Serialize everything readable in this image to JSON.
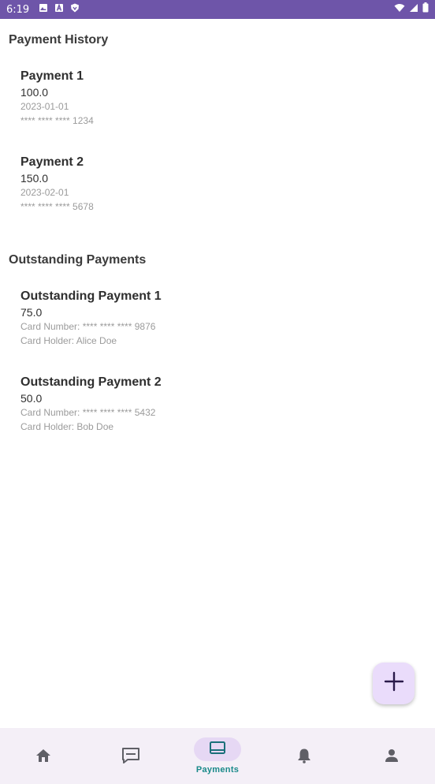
{
  "status_bar": {
    "time": "6:19",
    "left_icons": [
      "image-icon",
      "a-icon",
      "shield-icon"
    ],
    "right_icons": [
      "wifi-icon",
      "signal-icon",
      "battery-icon"
    ],
    "background": "#6e55a9"
  },
  "payment_history": {
    "title": "Payment History",
    "items": [
      {
        "title": "Payment 1",
        "amount": "100.0",
        "date": "2023-01-01",
        "card": "**** **** **** 1234"
      },
      {
        "title": "Payment 2",
        "amount": "150.0",
        "date": "2023-02-01",
        "card": "**** **** **** 5678"
      }
    ]
  },
  "outstanding_payments": {
    "title": "Outstanding Payments",
    "items": [
      {
        "title": "Outstanding Payment 1",
        "amount": "75.0",
        "card": "Card Number: **** **** **** 9876",
        "holder": "Card Holder: Alice Doe"
      },
      {
        "title": "Outstanding Payment 2",
        "amount": "50.0",
        "card": "Card Number: **** **** **** 5432",
        "holder": "Card Holder: Bob Doe"
      }
    ]
  },
  "fab": {
    "icon": "plus-icon",
    "color": "#eadcfb"
  },
  "bottom_nav": {
    "items": [
      {
        "icon": "home-icon",
        "label": ""
      },
      {
        "icon": "message-icon",
        "label": ""
      },
      {
        "icon": "payments-icon",
        "label": "Payments",
        "active": true
      },
      {
        "icon": "bell-icon",
        "label": ""
      },
      {
        "icon": "person-icon",
        "label": ""
      }
    ],
    "active_color": "#1a8a8a"
  }
}
